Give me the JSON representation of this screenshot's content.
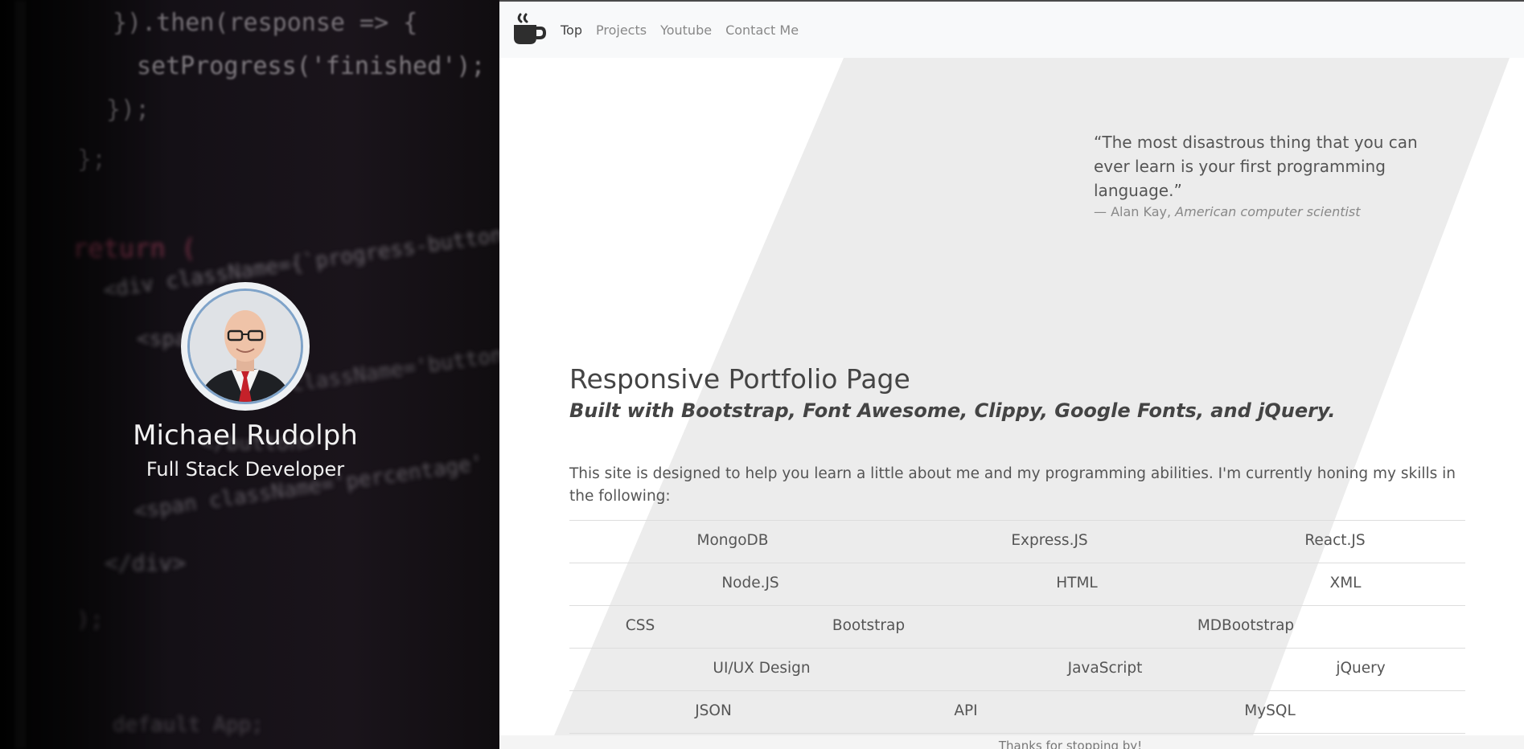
{
  "hero": {
    "name": "Michael Rudolph",
    "role": "Full Stack Developer",
    "code_lines": [
      "}).then(response => {",
      "setProgress('finished');",
      "});",
      "};",
      "return (",
      "<div className={`progress-button ${progress}`}",
      "<span",
      "<span className='button-text'",
      "</button>",
      "<span className='percentage'",
      "</div>",
      ");",
      "default App;"
    ]
  },
  "nav": {
    "brand_icon": "coffee-cup-icon",
    "links": [
      "Top",
      "Projects",
      "Youtube",
      "Contact Me"
    ]
  },
  "quote": {
    "text": "“The most disastrous thing that you can ever learn is your first programming language.”",
    "author": "— Alan Kay, ",
    "author_title": "American computer scientist"
  },
  "main": {
    "title": "Responsive Portfolio Page",
    "subtitle": "Built with Bootstrap, Font Awesome, Clippy, Google Fonts, and jQuery.",
    "intro": "This site is designed to help you learn a little about me and my programming abilities. I'm currently honing my skills in the following:"
  },
  "skills": [
    [
      "MongoDB",
      "Express.JS",
      "React.JS"
    ],
    [
      "Node.JS",
      "HTML",
      "XML"
    ],
    [
      "CSS",
      "Bootstrap",
      "MDBootstrap"
    ],
    [
      "UI/UX Design",
      "JavaScript",
      "jQuery"
    ],
    [
      "JSON",
      "API",
      "MySQL"
    ]
  ],
  "footer": {
    "text": "Thanks for stopping by!"
  },
  "colors": {
    "accent_slash": "#ececec",
    "nav_bg": "#f8f9fa",
    "hero_bg": "#141016"
  }
}
